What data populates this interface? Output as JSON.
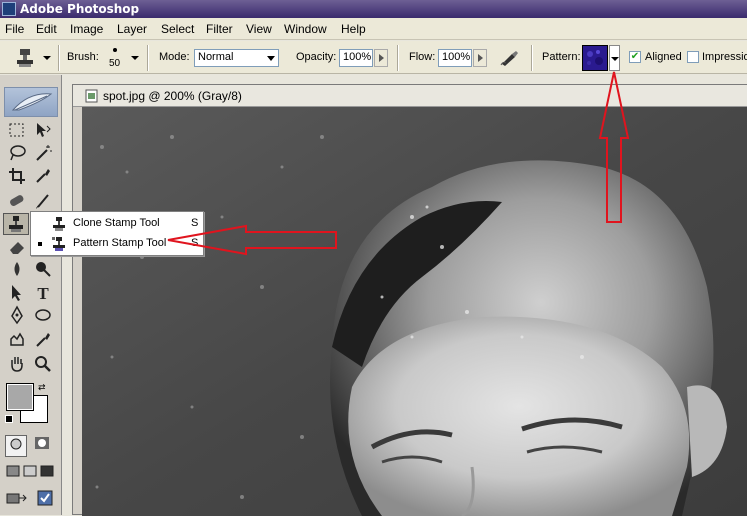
{
  "window": {
    "title": "Adobe Photoshop"
  },
  "menu": [
    "File",
    "Edit",
    "Image",
    "Layer",
    "Select",
    "Filter",
    "View",
    "Window",
    "Help"
  ],
  "options": {
    "brush_label": "Brush:",
    "brush_size": "50",
    "mode_label": "Mode:",
    "mode_value": "Normal",
    "opacity_label": "Opacity:",
    "opacity_value": "100%",
    "flow_label": "Flow:",
    "flow_value": "100%",
    "pattern_label": "Pattern:",
    "aligned_label": "Aligned",
    "aligned_checked": true,
    "impressionist_label": "Impression"
  },
  "document": {
    "title": "spot.jpg @ 200% (Gray/8)"
  },
  "flyout": {
    "items": [
      {
        "label": "Clone Stamp Tool",
        "shortcut": "S",
        "active": false
      },
      {
        "label": "Pattern Stamp Tool",
        "shortcut": "S",
        "active": true
      }
    ]
  },
  "colors": {
    "accent_arrow": "#e0141e",
    "pattern_swatch": "#2a1a8f",
    "title_bar": "#3a2a6d"
  },
  "icons": [
    "photoshop-logo-icon",
    "clone-stamp-icon",
    "pattern-stamp-icon",
    "marquee-icon",
    "move-icon",
    "lasso-icon",
    "magic-wand-icon",
    "crop-icon",
    "eyedropper-icon",
    "healing-brush-icon",
    "brush-icon",
    "history-brush-icon",
    "eraser-icon",
    "gradient-icon",
    "blur-icon",
    "path-selection-icon",
    "type-icon",
    "pen-icon",
    "shape-icon",
    "hand-icon",
    "zoom-icon",
    "notes-icon",
    "feather-icon",
    "document-icon"
  ]
}
